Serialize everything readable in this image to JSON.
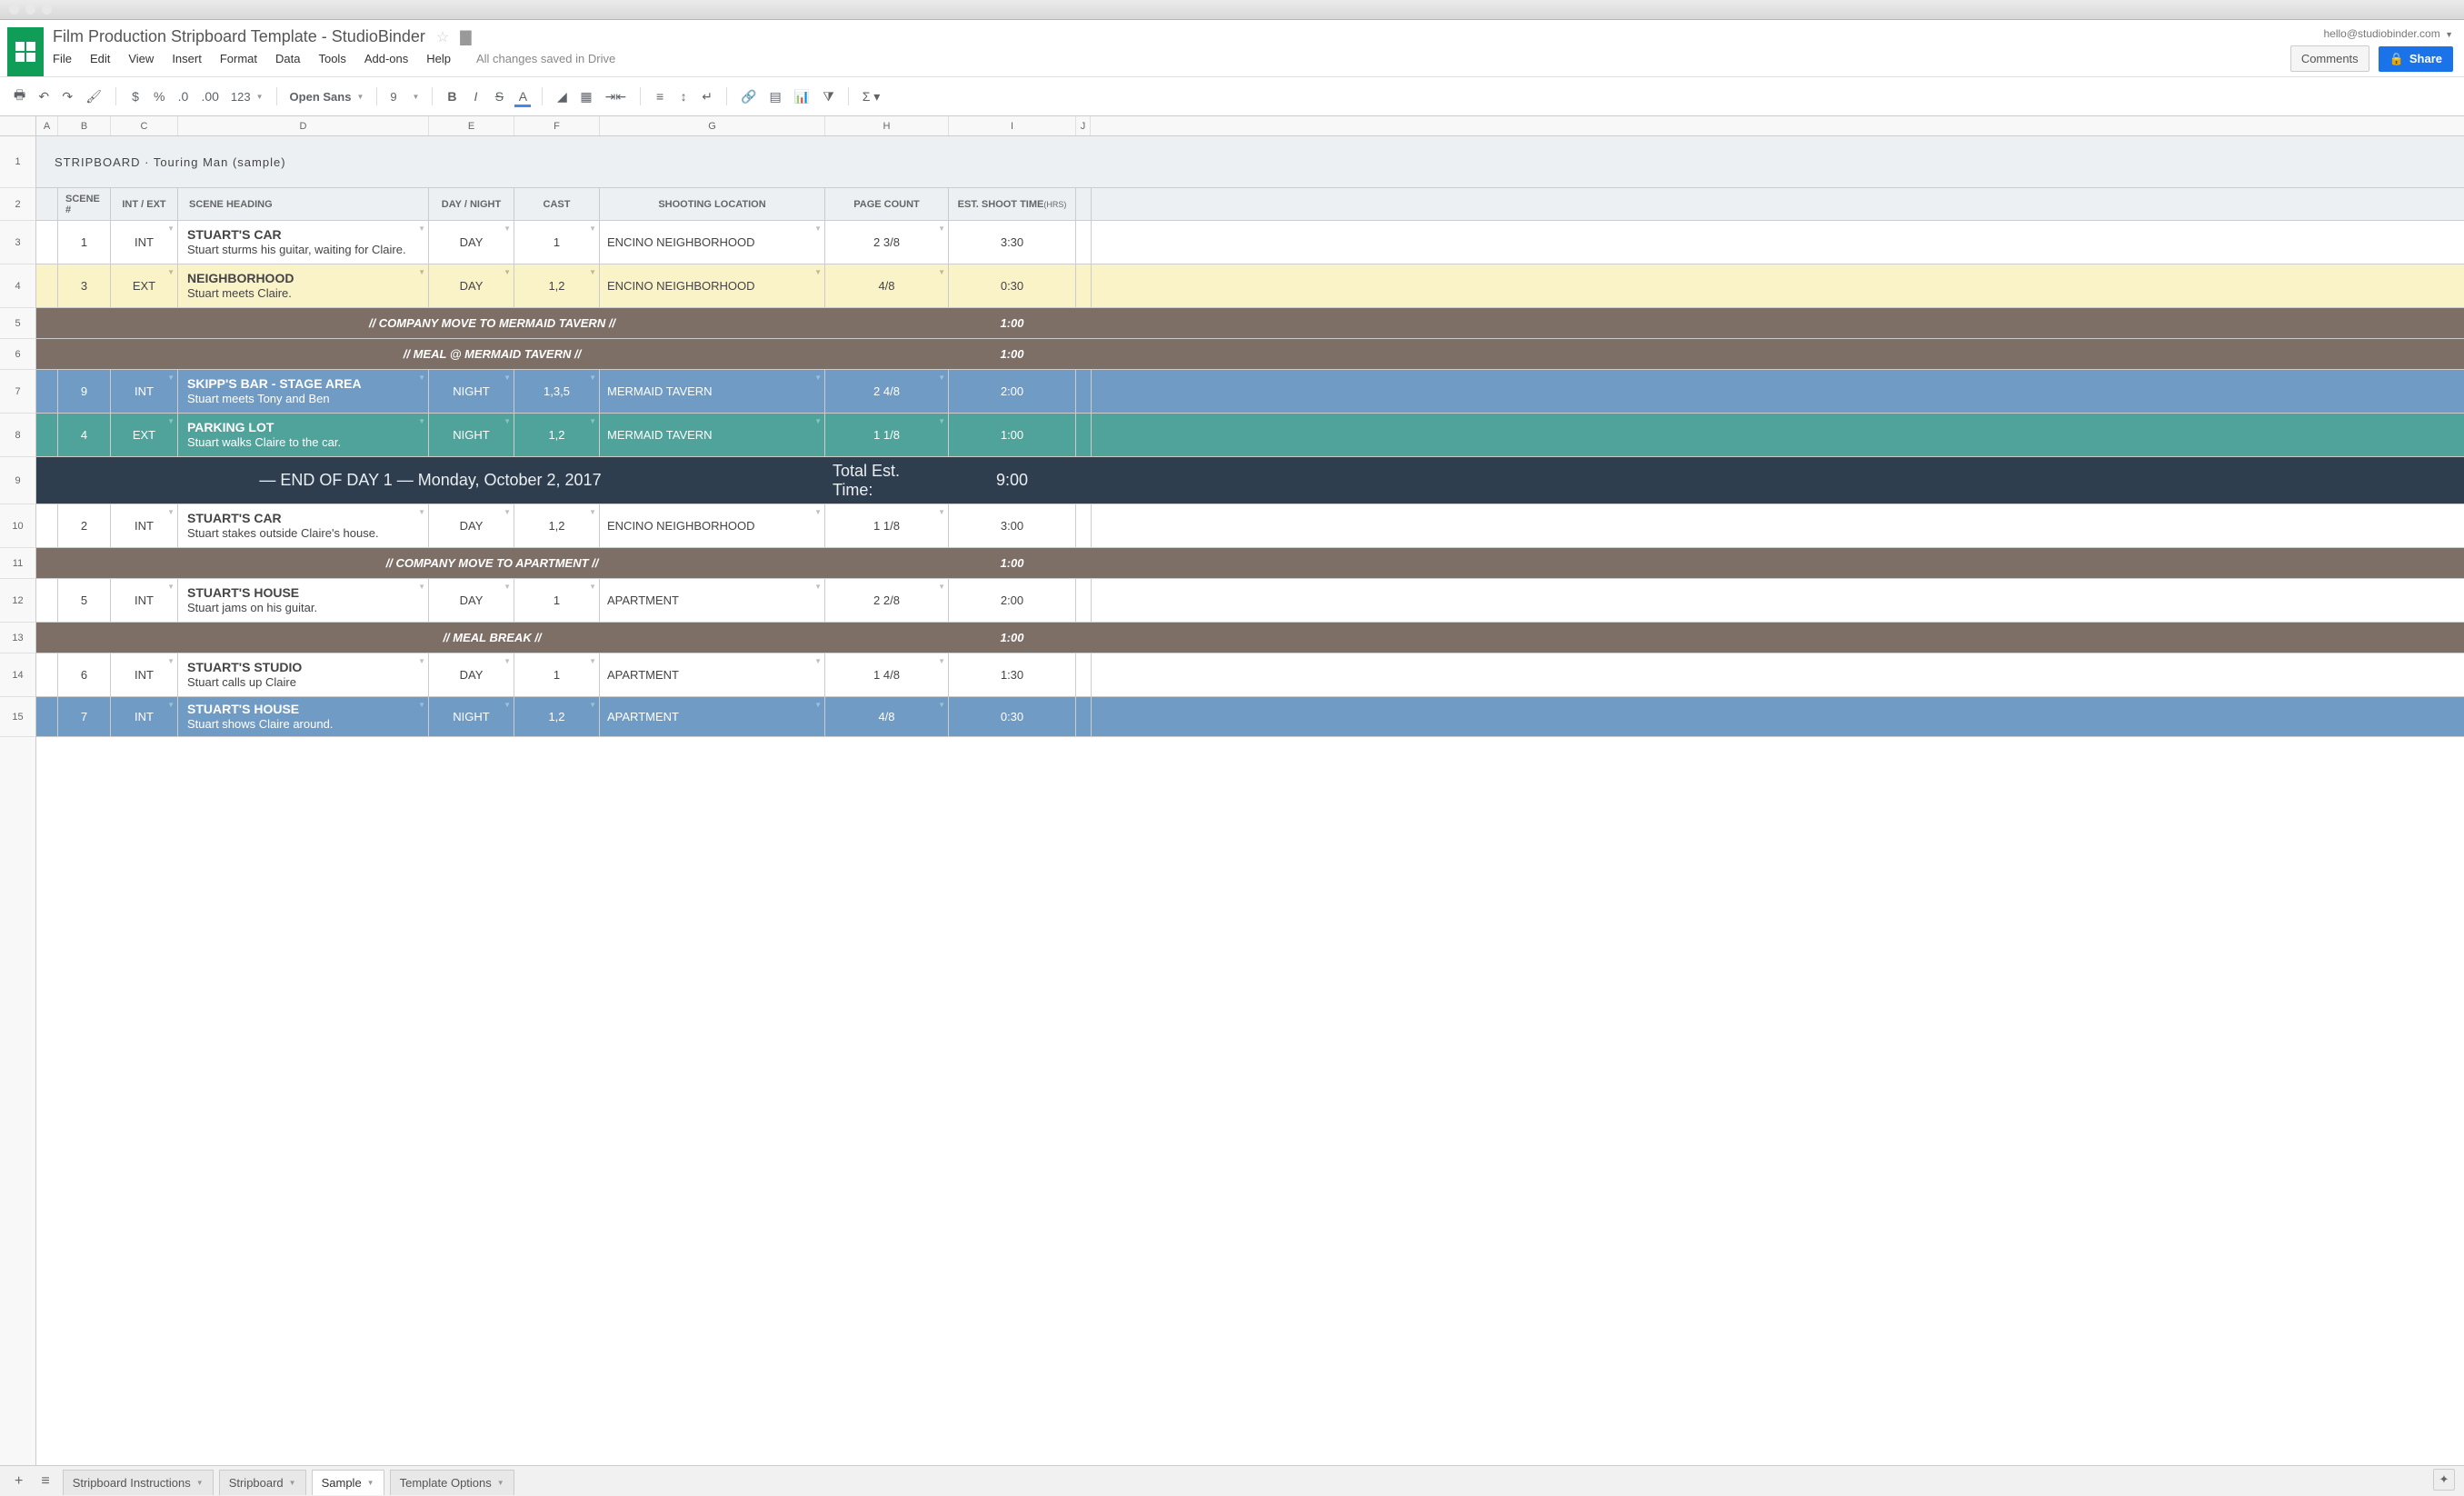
{
  "chrome": {},
  "header": {
    "doc_title": "Film Production Stripboard Template  -  StudioBinder",
    "user_email": "hello@studiobinder.com",
    "comments_btn": "Comments",
    "share_btn": "Share",
    "saved_text": "All changes saved in Drive",
    "menus": [
      "File",
      "Edit",
      "View",
      "Insert",
      "Format",
      "Data",
      "Tools",
      "Add-ons",
      "Help"
    ]
  },
  "toolbar": {
    "font_name": "Open Sans",
    "font_size": "9",
    "currency": "$",
    "percent": "%",
    "dec_dec": ".0",
    "dec_inc": ".00",
    "more_fmt": "123"
  },
  "columns": [
    "A",
    "B",
    "C",
    "D",
    "E",
    "F",
    "G",
    "H",
    "I",
    "J"
  ],
  "row_nums": [
    "1",
    "2",
    "3",
    "4",
    "5",
    "6",
    "7",
    "8",
    "9",
    "10",
    "11",
    "12",
    "13",
    "14",
    "15"
  ],
  "sheet_title": "STRIPBOARD · Touring Man (sample)",
  "headers": {
    "scene_num": "SCENE #",
    "int_ext": "INT / EXT",
    "scene_heading": "SCENE HEADING",
    "day_night": "DAY / NIGHT",
    "cast": "CAST",
    "shooting_location": "SHOOTING LOCATION",
    "page_count": "PAGE COUNT",
    "est_shoot_time": "EST. SHOOT TIME",
    "hrs": "(HRS)"
  },
  "rows": [
    {
      "type": "strip",
      "style": "strip-white",
      "h": 48,
      "scene": "1",
      "intext": "INT",
      "heading": "STUART'S CAR",
      "desc": "Stuart sturms his guitar, waiting for Claire.",
      "daynight": "DAY",
      "cast": "1",
      "location": "ENCINO NEIGHBORHOOD",
      "pages": "2 3/8",
      "time": "3:30"
    },
    {
      "type": "strip",
      "style": "strip-yellow",
      "h": 48,
      "scene": "3",
      "intext": "EXT",
      "heading": "NEIGHBORHOOD",
      "desc": "Stuart meets Claire.",
      "daynight": "DAY",
      "cast": "1,2",
      "location": "ENCINO NEIGHBORHOOD",
      "pages": "4/8",
      "time": "0:30"
    },
    {
      "type": "banner",
      "style": "banner-brown",
      "h": 34,
      "text": "// COMPANY MOVE TO MERMAID TAVERN //",
      "time": "1:00"
    },
    {
      "type": "banner",
      "style": "banner-brown",
      "h": 34,
      "text": "// MEAL @ MERMAID TAVERN //",
      "time": "1:00"
    },
    {
      "type": "strip",
      "style": "strip-blue",
      "h": 48,
      "scene": "9",
      "intext": "INT",
      "heading": "SKIPP'S BAR - STAGE AREA",
      "desc": "Stuart meets Tony and Ben",
      "daynight": "NIGHT",
      "cast": "1,3,5",
      "location": "MERMAID TAVERN",
      "pages": "2 4/8",
      "time": "2:00"
    },
    {
      "type": "strip",
      "style": "strip-teal",
      "h": 48,
      "scene": "4",
      "intext": "EXT",
      "heading": "PARKING LOT",
      "desc": "Stuart walks Claire to the car.",
      "daynight": "NIGHT",
      "cast": "1,2",
      "location": "MERMAID TAVERN",
      "pages": "1 1/8",
      "time": "1:00"
    },
    {
      "type": "eod",
      "h": 52,
      "text": "— END OF DAY 1 —  Monday, October 2, 2017",
      "total_label": "Total Est. Time:",
      "time": "9:00"
    },
    {
      "type": "strip",
      "style": "strip-white",
      "h": 48,
      "scene": "2",
      "intext": "INT",
      "heading": "STUART'S CAR",
      "desc": "Stuart stakes outside Claire's house.",
      "daynight": "DAY",
      "cast": "1,2",
      "location": "ENCINO NEIGHBORHOOD",
      "pages": "1 1/8",
      "time": "3:00"
    },
    {
      "type": "banner",
      "style": "banner-brown",
      "h": 34,
      "text": "// COMPANY MOVE TO APARTMENT //",
      "time": "1:00"
    },
    {
      "type": "strip",
      "style": "strip-white",
      "h": 48,
      "scene": "5",
      "intext": "INT",
      "heading": "STUART'S HOUSE",
      "desc": "Stuart jams on his guitar.",
      "daynight": "DAY",
      "cast": "1",
      "location": "APARTMENT",
      "pages": "2 2/8",
      "time": "2:00"
    },
    {
      "type": "banner",
      "style": "banner-brown",
      "h": 34,
      "text": "// MEAL BREAK //",
      "time": "1:00"
    },
    {
      "type": "strip",
      "style": "strip-white",
      "h": 48,
      "scene": "6",
      "intext": "INT",
      "heading": "STUART'S STUDIO",
      "desc": "Stuart calls up Claire",
      "daynight": "DAY",
      "cast": "1",
      "location": "APARTMENT",
      "pages": "1 4/8",
      "time": "1:30"
    },
    {
      "type": "strip",
      "style": "strip-blue",
      "h": 44,
      "scene": "7",
      "intext": "INT",
      "heading": "STUART'S HOUSE",
      "desc": "Stuart shows Claire around.",
      "daynight": "NIGHT",
      "cast": "1,2",
      "location": "APARTMENT",
      "pages": "4/8",
      "time": "0:30"
    }
  ],
  "tabs": {
    "items": [
      "Stripboard Instructions",
      "Stripboard",
      "Sample",
      "Template Options"
    ],
    "active": 2
  }
}
